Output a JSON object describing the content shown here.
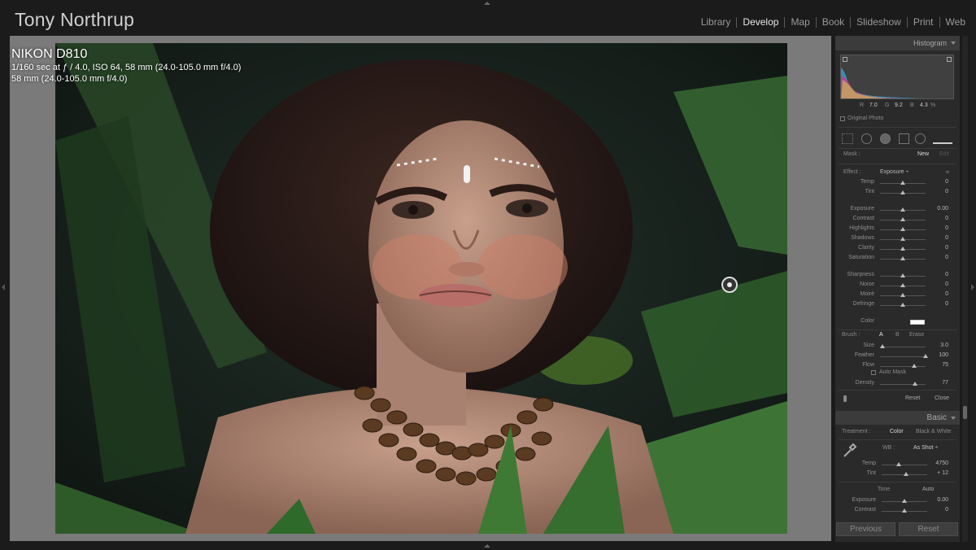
{
  "identity": "Tony Northrup",
  "modules": [
    {
      "label": "Library",
      "active": false
    },
    {
      "label": "Develop",
      "active": true
    },
    {
      "label": "Map",
      "active": false
    },
    {
      "label": "Book",
      "active": false
    },
    {
      "label": "Slideshow",
      "active": false
    },
    {
      "label": "Print",
      "active": false
    },
    {
      "label": "Web",
      "active": false
    }
  ],
  "exif": {
    "camera": "NIKON D810",
    "settings": "1/160 sec at ƒ / 4.0, ISO 64, 58 mm (24.0-105.0 mm f/4.0)",
    "lens": "58 mm (24.0-105.0 mm f/4.0)"
  },
  "histogram": {
    "title": "Histogram",
    "r_label": "R",
    "r_value": "7.0",
    "g_label": "G",
    "g_value": "9.2",
    "b_label": "B",
    "b_value": "4.3",
    "pct": "%",
    "original_photo": "Original Photo"
  },
  "mask": {
    "label": "Mask :",
    "new": "New",
    "edit": "Edit"
  },
  "effect": {
    "label": "Effect :",
    "value": "Exposure ÷",
    "sliders": [
      {
        "label": "Temp",
        "value": "0",
        "pos": 0.5
      },
      {
        "label": "Tint",
        "value": "0",
        "pos": 0.5
      },
      {
        "label": "Exposure",
        "value": "0.00",
        "pos": 0.5
      },
      {
        "label": "Contrast",
        "value": "0",
        "pos": 0.5
      },
      {
        "label": "Highlights",
        "value": "0",
        "pos": 0.5
      },
      {
        "label": "Shadows",
        "value": "0",
        "pos": 0.5
      },
      {
        "label": "Clarity",
        "value": "0",
        "pos": 0.5
      },
      {
        "label": "Saturation",
        "value": "0",
        "pos": 0.5
      },
      {
        "label": "Sharpness",
        "value": "0",
        "pos": 0.5
      },
      {
        "label": "Noise",
        "value": "0",
        "pos": 0.5
      },
      {
        "label": "Moiré",
        "value": "0",
        "pos": 0.5
      },
      {
        "label": "Defringe",
        "value": "0",
        "pos": 0.5
      }
    ],
    "color_label": "Color"
  },
  "brush": {
    "label": "Brush :",
    "a": "A",
    "b": "B",
    "erase": "Erase",
    "sliders": [
      {
        "label": "Size",
        "value": "3.0",
        "pos": 0.05
      },
      {
        "label": "Feather",
        "value": "100",
        "pos": 1.0
      },
      {
        "label": "Flow",
        "value": "75",
        "pos": 0.75
      }
    ],
    "automask": "Auto Mask",
    "density": {
      "label": "Density",
      "value": "77",
      "pos": 0.77
    },
    "reset": "Reset",
    "close": "Close"
  },
  "basic": {
    "title": "Basic",
    "treatment_label": "Treatment :",
    "color": "Color",
    "bw": "Black & White",
    "wb_label": "WB :",
    "wb_value": "As Shot ÷",
    "temp": {
      "label": "Temp",
      "value": "4750",
      "pos": 0.38
    },
    "tint": {
      "label": "Tint",
      "value": "+ 12",
      "pos": 0.54
    },
    "tone": "Tone",
    "auto": "Auto",
    "exposure": {
      "label": "Exposure",
      "value": "0.00",
      "pos": 0.5
    },
    "contrast": {
      "label": "Contrast",
      "value": "0",
      "pos": 0.5
    }
  },
  "buttons": {
    "previous": "Previous",
    "reset": "Reset"
  }
}
